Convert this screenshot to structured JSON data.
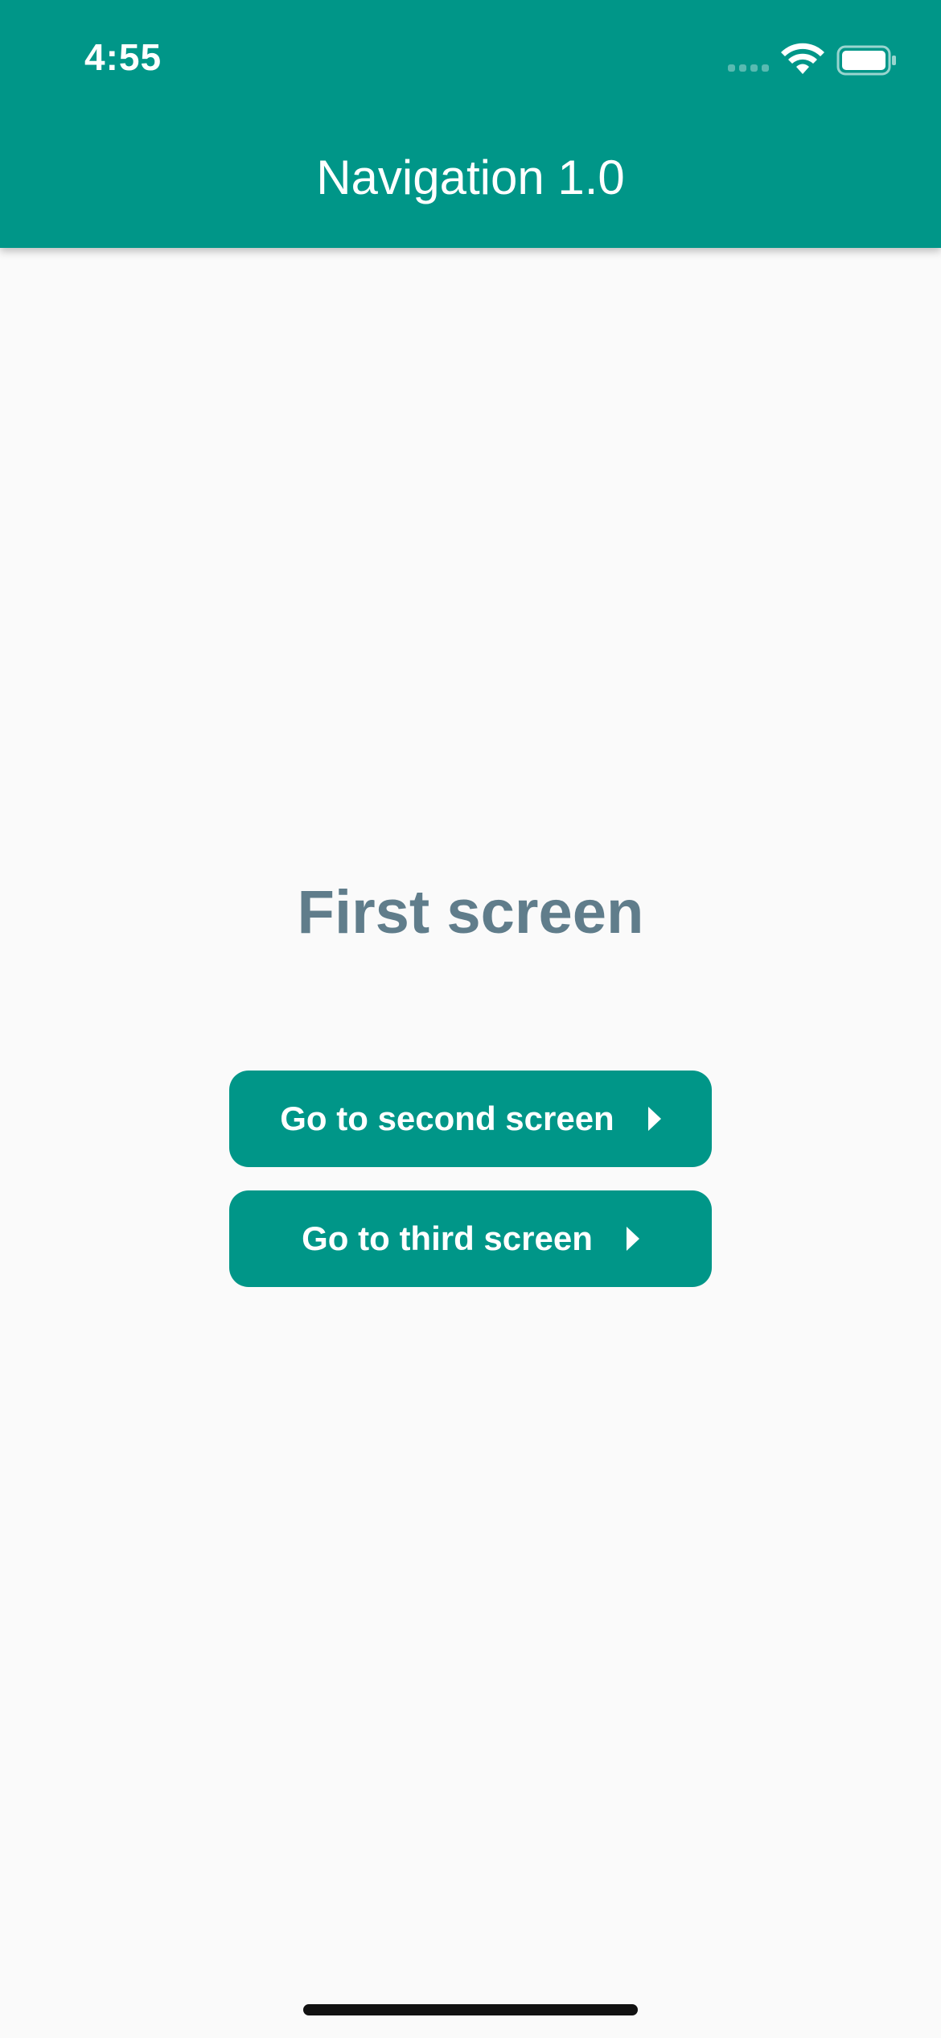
{
  "status_bar": {
    "time": "4:55",
    "icons": [
      "cell-signal-icon",
      "wifi-icon",
      "battery-icon"
    ]
  },
  "header": {
    "title": "Navigation 1.0",
    "background_color": "#009688"
  },
  "main": {
    "title": "First screen",
    "title_color": "#607d8b",
    "buttons": [
      {
        "label": "Go to second screen",
        "icon": "arrow-right-icon"
      },
      {
        "label": "Go to third screen",
        "icon": "arrow-right-icon"
      }
    ],
    "button_color": "#009688"
  },
  "background_color": "#fafafa"
}
